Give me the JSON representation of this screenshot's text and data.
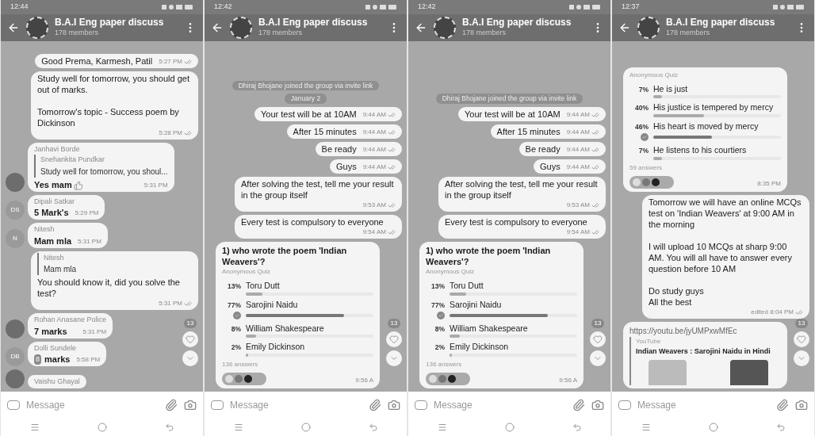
{
  "phones": [
    {
      "status_time": "12:44",
      "title": "B.A.I Eng paper discuss",
      "subtitle": "178 members",
      "composer": {
        "placeholder": "Message"
      },
      "badge": "13",
      "messages": [
        {
          "kind": "out",
          "text": "Good Prema, Karmesh, Patil",
          "time": "5:27 PM"
        },
        {
          "kind": "out",
          "text": "Study well for tomorrow, you should get out of marks.\n\nTomorrow's topic - Success poem by Dickinson",
          "time": "5:28 PM"
        },
        {
          "kind": "in",
          "avatar": {
            "kind": "photo"
          },
          "sender": "Janhavi Borde",
          "quote": {
            "author": "Snehankita Pundkar",
            "text": "Study well for tomorrow, you shoul..."
          },
          "text": "Yes mam",
          "thumbs_up": true,
          "time": "5:31 PM"
        },
        {
          "kind": "in",
          "avatar": {
            "kind": "initials",
            "text": "DS"
          },
          "sender": "Dipali Satkar",
          "text": "5 Mark's",
          "time": "5:29 PM"
        },
        {
          "kind": "in",
          "avatar": {
            "kind": "initials",
            "text": "N"
          },
          "sender": "Nitesh",
          "text": "Mam mla",
          "time": "5:31 PM"
        },
        {
          "kind": "out",
          "quote": {
            "author": "Nitesh",
            "text": "Mam mla"
          },
          "text": "You should know it, did you solve the test?",
          "time": "5:31 PM"
        },
        {
          "kind": "in",
          "avatar": {
            "kind": "photo"
          },
          "sender": "Rohan Anasane Police",
          "text": "7 marks",
          "time": "5:31 PM"
        },
        {
          "kind": "in",
          "avatar": {
            "kind": "initials",
            "text": "DB"
          },
          "sender": "Dolli Sundele",
          "keycap": "8",
          "text": "marks",
          "time": "5:58 PM"
        },
        {
          "kind": "in",
          "avatar": {
            "kind": "photo"
          },
          "sender": "Vaishu Ghayal"
        }
      ]
    },
    {
      "status_time": "12:42",
      "title": "B.A.I Eng paper discuss",
      "subtitle": "178 members",
      "composer": {
        "placeholder": "Message"
      },
      "badge": "13",
      "messages": [
        {
          "kind": "service",
          "text": "Dhiraj Bhojane joined the group via invite link"
        },
        {
          "kind": "service",
          "text": "January 2"
        },
        {
          "kind": "out",
          "text": "Your test will be at 10AM",
          "time": "9:44 AM"
        },
        {
          "kind": "out",
          "text": "After 15 minutes",
          "time": "9:44 AM"
        },
        {
          "kind": "out",
          "text": "Be ready",
          "time": "9:44 AM"
        },
        {
          "kind": "out",
          "text": "Guys",
          "time": "9:44 AM"
        },
        {
          "kind": "out",
          "text": "After solving the test, tell me your result in the group itself",
          "time": "9:53 AM"
        },
        {
          "kind": "out",
          "text": "Every test is compulsory to everyone",
          "time": "9:54 AM"
        },
        {
          "kind": "poll",
          "question": "1) who wrote the poem 'Indian Weavers'?",
          "type_label": "Anonymous Quiz",
          "answers": "136 answers",
          "time": "9:56 A",
          "reactions": true,
          "options": [
            {
              "percent": "13%",
              "label": "Toru Dutt",
              "level": 0.13,
              "correct": false
            },
            {
              "percent": "77%",
              "label": "Sarojini Naidu",
              "level": 0.77,
              "correct": true
            },
            {
              "percent": "8%",
              "label": "William Shakespeare",
              "level": 0.08,
              "correct": false
            },
            {
              "percent": "2%",
              "label": "Emily Dickinson",
              "level": 0.02,
              "correct": false
            }
          ]
        }
      ]
    },
    {
      "status_time": "12:42",
      "title": "B.A.I Eng paper discuss",
      "subtitle": "178 members",
      "composer": {
        "placeholder": "Message"
      },
      "badge": "13",
      "messages": [
        {
          "kind": "service",
          "text": "Dhiraj Bhojane joined the group via invite link"
        },
        {
          "kind": "out",
          "text": "Your test will be at 10AM",
          "time": "9:44 AM"
        },
        {
          "kind": "out",
          "text": "After 15 minutes",
          "time": "9:44 AM"
        },
        {
          "kind": "out",
          "text": "Be ready",
          "time": "9:44 AM"
        },
        {
          "kind": "out",
          "text": "Guys",
          "time": "9:44 AM"
        },
        {
          "kind": "out",
          "text": "After solving the test, tell me your result in the group itself",
          "time": "9:53 AM"
        },
        {
          "kind": "out",
          "text": "Every test is compulsory to everyone",
          "time": "9:54 AM"
        },
        {
          "kind": "poll",
          "question": "1) who wrote the poem 'Indian Weavers'?",
          "type_label": "Anonymous Quiz",
          "answers": "136 answers",
          "time": "9:56 A",
          "reactions": true,
          "options": [
            {
              "percent": "13%",
              "label": "Toru Dutt",
              "level": 0.13,
              "correct": false
            },
            {
              "percent": "77%",
              "label": "Sarojini Naidu",
              "level": 0.77,
              "correct": true
            },
            {
              "percent": "8%",
              "label": "William Shakespeare",
              "level": 0.08,
              "correct": false
            },
            {
              "percent": "2%",
              "label": "Emily Dickinson",
              "level": 0.02,
              "correct": false
            }
          ]
        }
      ]
    },
    {
      "status_time": "12:37",
      "title": "B.A.I Eng paper discuss",
      "subtitle": "178 members",
      "composer": {
        "placeholder": "Message"
      },
      "badge": "13",
      "messages": [
        {
          "kind": "poll",
          "type_label": "Anonymous Quiz",
          "answers": "59 answers",
          "time": "8:35 PM",
          "reactions": true,
          "options": [
            {
              "percent": "7%",
              "label": "He is just",
              "level": 0.07,
              "correct": false
            },
            {
              "percent": "40%",
              "label": "His justice is tempered by mercy",
              "level": 0.4,
              "correct": false
            },
            {
              "percent": "46%",
              "label": "His heart is moved by mercy",
              "level": 0.46,
              "correct": true
            },
            {
              "percent": "7%",
              "label": "He listens to his courtiers",
              "level": 0.07,
              "correct": false
            }
          ]
        },
        {
          "kind": "out",
          "text": "Tomorrow we will have an online MCQs test on 'Indian Weavers' at 9:00 AM in the morning\n\nI will upload 10 MCQs at sharp 9:00 AM. You will all have to answer every question before 10 AM\n\nDo study guys\nAll the best",
          "time": "edited 8:04 PM"
        },
        {
          "kind": "link",
          "url": "https://youtu.be/jyUMPxwMfEc",
          "site": "YouTube",
          "title": "Indian Weavers : Sarojini Naidu in Hindi"
        }
      ]
    }
  ]
}
